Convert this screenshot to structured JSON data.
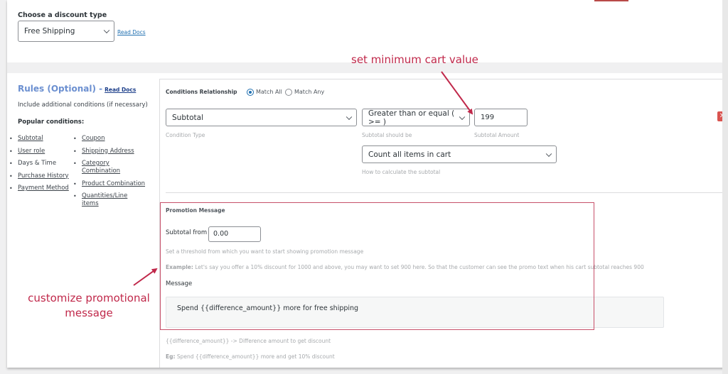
{
  "discount_type": {
    "label": "Choose a discount type",
    "selected": "Free Shipping",
    "read_docs": "Read Docs"
  },
  "rules": {
    "title": "Rules (Optional) -",
    "read_docs": "Read Docs",
    "description": "Include additional conditions (if necessary)",
    "popular_label": "Popular conditions:",
    "popular_col1": [
      {
        "label": "Subtotal",
        "link": true
      },
      {
        "label": "User role",
        "link": true
      },
      {
        "label": "Days & Time",
        "link": false
      },
      {
        "label": "Purchase History",
        "link": true
      },
      {
        "label": "Payment Method",
        "link": true
      }
    ],
    "popular_col2": [
      {
        "label": "Coupon",
        "link": true
      },
      {
        "label": "Shipping Address",
        "link": true
      },
      {
        "label": "Category Combination",
        "link": true
      },
      {
        "label": "Product Combination",
        "link": true
      },
      {
        "label": "Quantities/Line items",
        "link": true
      }
    ]
  },
  "conditions": {
    "relationship_label": "Conditions Relationship",
    "match_all": "Match All",
    "match_any": "Match Any",
    "selected_relationship": "Match All",
    "condition_type": {
      "value": "Subtotal",
      "hint": "Condition Type"
    },
    "operator": {
      "value": "Greater than or equal ( >= )",
      "hint": "Subtotal should be"
    },
    "amount": {
      "value": "199",
      "hint": "Subtotal Amount"
    },
    "calculation": {
      "value": "Count all items in cart",
      "hint": "How to calculate the subtotal"
    },
    "remove_icon": "close-icon"
  },
  "promotion": {
    "title": "Promotion Message",
    "subtotal_from_label": "Subtotal from",
    "subtotal_from_value": "0.00",
    "threshold_hint": "Set a threshold from which you want to start showing promotion message",
    "example_label": "Example:",
    "example_text": " Let's say you offer a 10% discount for 1000 and above, you may want to set 900 here. So that the customer can see the promo text when his cart subtotal reaches 900",
    "message_label": "Message",
    "message_value": "Spend {{difference_amount}}  more for free shipping",
    "placeholder_hint": "{{difference_amount}} -> Difference amount to get discount",
    "eg_label": "Eg:",
    "eg_text": " Spend {{difference_amount}} more and get 10% discount"
  },
  "annotations": {
    "min_cart": "set minimum cart value",
    "promo_line1": "customize promotional",
    "promo_line2": "message",
    "color": "#c0284a"
  }
}
